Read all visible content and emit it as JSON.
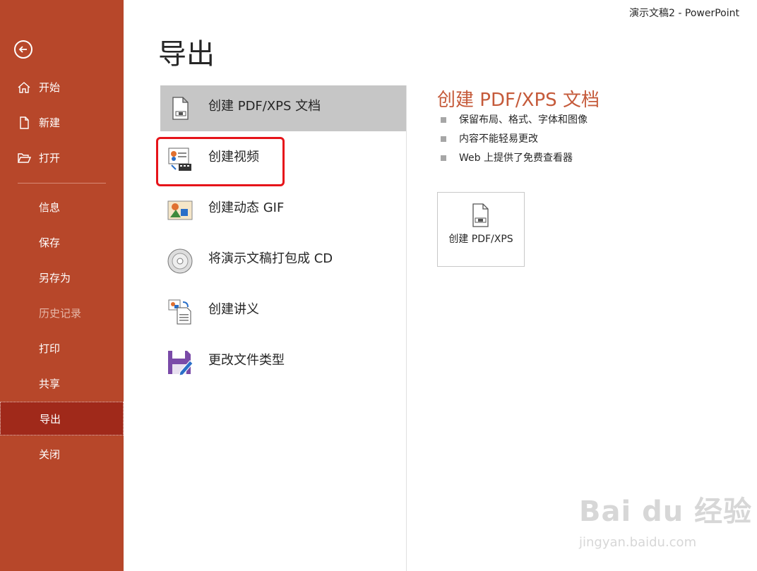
{
  "window": {
    "title": "演示文稿2  -  PowerPoint"
  },
  "colors": {
    "sidebar": "#b7472a",
    "sidebar_active": "#a0291a",
    "accent_text": "#c55a3a",
    "highlight": "#e6141a"
  },
  "sidebar": {
    "back_icon": "arrow-left-circle-icon",
    "items": [
      {
        "label": "开始",
        "icon": "home-icon"
      },
      {
        "label": "新建",
        "icon": "new-file-icon"
      },
      {
        "label": "打开",
        "icon": "folder-open-icon"
      },
      {
        "label": "信息"
      },
      {
        "label": "保存"
      },
      {
        "label": "另存为"
      },
      {
        "label": "历史记录",
        "disabled": true
      },
      {
        "label": "打印"
      },
      {
        "label": "共享"
      },
      {
        "label": "导出",
        "active": true
      },
      {
        "label": "关闭"
      }
    ]
  },
  "main": {
    "title": "导出",
    "options": [
      {
        "label": "创建 PDF/XPS 文档",
        "icon": "pdf-document-icon",
        "selected": true
      },
      {
        "label": "创建视频",
        "icon": "create-video-icon",
        "highlighted": true
      },
      {
        "label": "创建动态 GIF",
        "icon": "gif-image-icon"
      },
      {
        "label": "将演示文稿打包成 CD",
        "icon": "cd-disc-icon"
      },
      {
        "label": "创建讲义",
        "icon": "handout-icon"
      },
      {
        "label": "更改文件类型",
        "icon": "save-file-type-icon"
      }
    ]
  },
  "detail": {
    "title": "创建 PDF/XPS 文档",
    "bullets": [
      "保留布局、格式、字体和图像",
      "内容不能轻易更改",
      "Web 上提供了免费查看器"
    ],
    "button_label": "创建 PDF/XPS"
  },
  "watermark": {
    "main": "Bai du 经验",
    "url": "jingyan.baidu.com"
  }
}
